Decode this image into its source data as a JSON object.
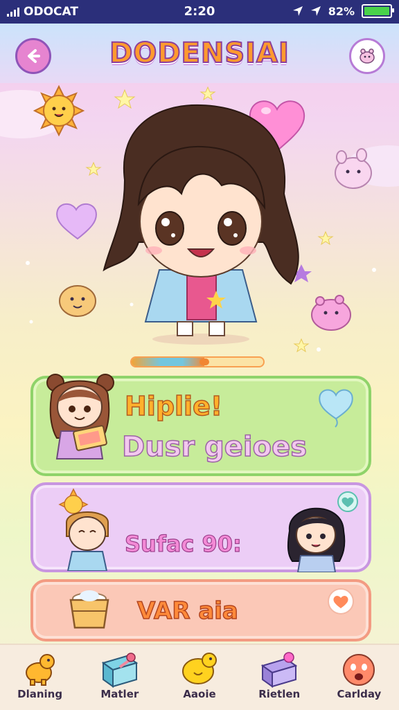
{
  "status_bar": {
    "carrier": "ODOCAT",
    "time": "2:20",
    "battery_text": "82%"
  },
  "header": {
    "title": "DODENSIAI"
  },
  "hero": {
    "progress": 0.55
  },
  "cards": [
    {
      "title": "Hiplie!",
      "subtitle": "Dusr geioes"
    },
    {
      "text": "Sufac 90:"
    },
    {
      "text": "VAR aia"
    }
  ],
  "nav": {
    "items": [
      {
        "label": "Dlaning",
        "icon": "dinosaur-icon"
      },
      {
        "label": "Matler",
        "icon": "gift-box-icon"
      },
      {
        "label": "Aaoie",
        "icon": "duck-icon"
      },
      {
        "label": "Rietlen",
        "icon": "treasure-box-icon"
      },
      {
        "label": "Carlday",
        "icon": "face-icon"
      }
    ]
  },
  "colors": {
    "status_bar": "#2b2f7a",
    "accent": "#b77bd6",
    "title_fill": "#ff9a2e"
  }
}
